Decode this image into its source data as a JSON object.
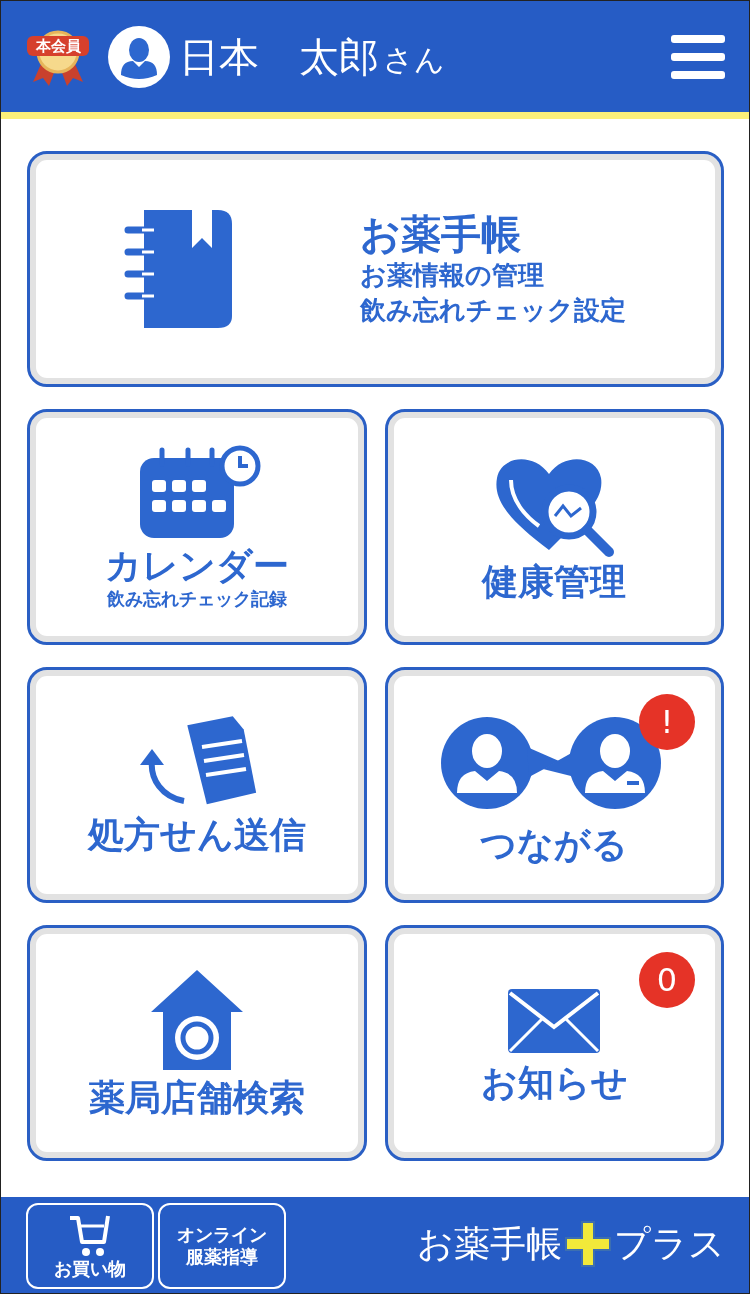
{
  "header": {
    "member_badge": "本会員",
    "user_name": "日本　太郎",
    "honorific": "さん"
  },
  "tiles": [
    {
      "kind": "notebook",
      "title": "お薬手帳",
      "subtitle": [
        "お薬情報の管理",
        "飲み忘れチェック設定"
      ],
      "wide": true
    },
    {
      "kind": "calendar",
      "title": "カレンダー",
      "subtitle": [
        "飲み忘れチェック記録"
      ],
      "wide": false
    },
    {
      "kind": "health",
      "title": "健康管理",
      "wide": false
    },
    {
      "kind": "prescription",
      "title": "処方せん送信",
      "wide": false
    },
    {
      "kind": "connect",
      "title": "つながる",
      "wide": false,
      "badge": "!"
    },
    {
      "kind": "pharmacy",
      "title": "薬局店舗検索",
      "wide": false
    },
    {
      "kind": "mail",
      "title": "お知らせ",
      "wide": false,
      "badge": "0"
    }
  ],
  "footer": {
    "buttons": [
      {
        "kind": "cart",
        "lines": [
          "お買い物"
        ]
      },
      {
        "kind": "text",
        "lines": [
          "オンライン",
          "服薬指導"
        ]
      }
    ],
    "logo_left": "お薬手帳",
    "logo_right": "プラス"
  }
}
